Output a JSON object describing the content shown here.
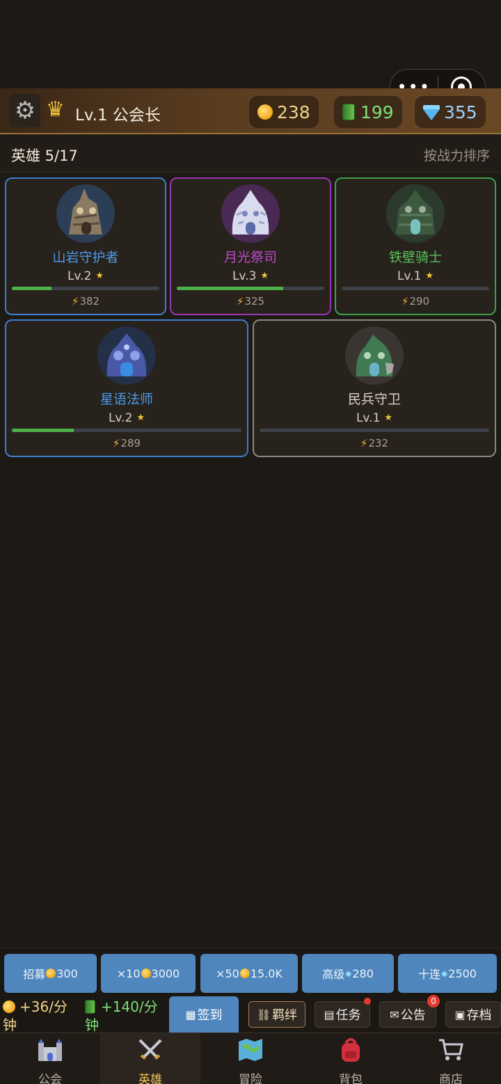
{
  "topbar": {
    "level_title": "Lv.1 公会长",
    "gold": "238",
    "books": "199",
    "gems": "355"
  },
  "capsule": {
    "more": "•••"
  },
  "hero_header": {
    "count": "英雄 5/17",
    "sort": "按战力排序"
  },
  "heroes": [
    {
      "name": "山岩守护者",
      "level": "Lv.2",
      "power": "382",
      "exp_fraction": 0.27,
      "name_color": "#4b9be8",
      "border_color": "#3a7fd0"
    },
    {
      "name": "月光祭司",
      "level": "Lv.3",
      "power": "325",
      "exp_fraction": 0.72,
      "name_color": "#c04ad0",
      "border_color": "#9a36b0"
    },
    {
      "name": "铁壁骑士",
      "level": "Lv.1",
      "power": "290",
      "exp_fraction": 0.0,
      "name_color": "#56c25a",
      "border_color": "#3ea04a"
    },
    {
      "name": "星语法师",
      "level": "Lv.2",
      "power": "289",
      "exp_fraction": 0.27,
      "name_color": "#4b9be8",
      "border_color": "#3a7fd0"
    },
    {
      "name": "民兵守卫",
      "level": "Lv.1",
      "power": "232",
      "exp_fraction": 0.0,
      "name_color": "#d8d2c8",
      "border_color": "#8c8780"
    }
  ],
  "recruit": {
    "single_label": "招募",
    "single_cost": "300",
    "x10_label": "×10",
    "x10_cost": "3000",
    "x50_label": "×50",
    "x50_cost": "15.0K",
    "adv_label": "高级",
    "adv_cost": "280",
    "ten_label": "十连",
    "ten_cost": "2500"
  },
  "income": {
    "gold": "+36/分钟",
    "books": "+140/分钟"
  },
  "actions": {
    "signin": "签到",
    "bond": "羁绊",
    "task": "任务",
    "notice": "公告",
    "notice_badge": "0",
    "save": "存档"
  },
  "tabs": [
    {
      "label": "公会",
      "icon": "castle-icon"
    },
    {
      "label": "英雄",
      "icon": "crossed-swords-icon"
    },
    {
      "label": "冒险",
      "icon": "map-icon"
    },
    {
      "label": "背包",
      "icon": "backpack-icon"
    },
    {
      "label": "商店",
      "icon": "cart-icon"
    }
  ]
}
